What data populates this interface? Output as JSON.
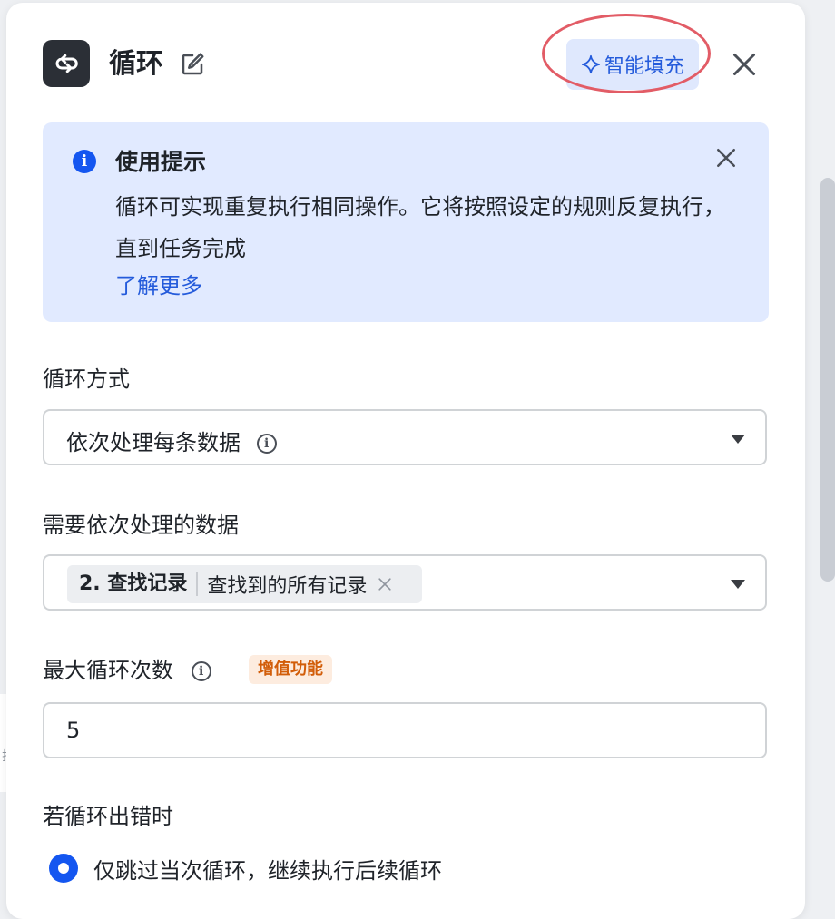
{
  "background": {
    "partial_text": "拉"
  },
  "header": {
    "title": "循环",
    "ai_fill_label": "智能填充"
  },
  "tip": {
    "title": "使用提示",
    "body": "循环可实现重复执行相同操作。它将按照设定的规则反复执行，直到任务完成",
    "link": "了解更多"
  },
  "loop_mode": {
    "label": "循环方式",
    "value": "依次处理每条数据"
  },
  "data_source": {
    "label": "需要依次处理的数据",
    "tag_step": "2. 查找记录",
    "tag_value": "查找到的所有记录"
  },
  "max_loops": {
    "label": "最大循环次数",
    "badge": "增值功能",
    "value": "5"
  },
  "on_error": {
    "label": "若循环出错时",
    "option_selected": "仅跳过当次循环，继续执行后续循环"
  },
  "colors": {
    "accent": "#1456f0",
    "tip_bg": "#e1eaff",
    "badge_bg": "#fdecdf",
    "badge_text": "#d25d09",
    "highlight": "#e25c66"
  },
  "icons": [
    "loop-icon",
    "edit-icon",
    "sparkle-icon",
    "close-icon",
    "info-icon",
    "caret-down-icon"
  ]
}
